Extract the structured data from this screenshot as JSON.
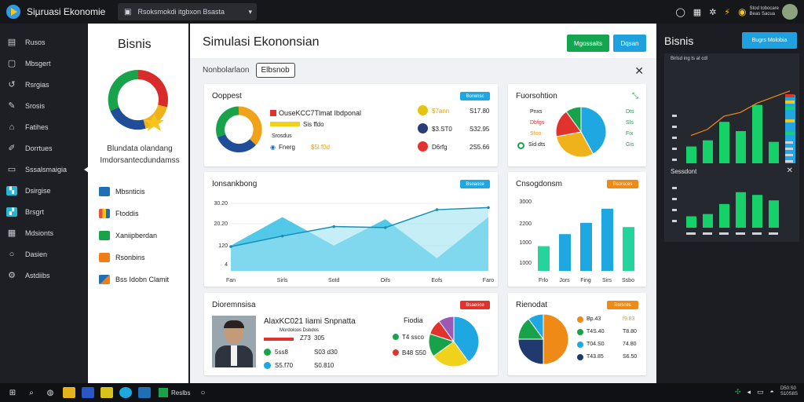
{
  "topbar": {
    "app_title": "Siµruasi Ekonomie",
    "search_text": "Rsoksmokdi itgbxon Bsasta",
    "user_line1": "Stod tobocare",
    "user_line2": "Beas Sacua"
  },
  "sidebar": {
    "items": [
      {
        "label": "Rusos",
        "icon": "grid-icon"
      },
      {
        "label": "Mbsgert",
        "icon": "window-icon"
      },
      {
        "label": "Rsrgias",
        "icon": "refresh-icon"
      },
      {
        "label": "Srosis",
        "icon": "wrench-icon"
      },
      {
        "label": "Fatihes",
        "icon": "folder-icon"
      },
      {
        "label": "Dorrtues",
        "icon": "pencil-icon"
      },
      {
        "label": "Sssalsmaigia",
        "icon": "monitor-icon"
      },
      {
        "label": "Dsirgise",
        "icon": "chart-icon"
      },
      {
        "label": "Brsgrt",
        "icon": "stats-icon"
      },
      {
        "label": "Mdsionts",
        "icon": "table-icon"
      },
      {
        "label": "Dasien",
        "icon": "circle-icon"
      },
      {
        "label": "Astdiibs",
        "icon": "gear-icon"
      }
    ]
  },
  "leftpanel": {
    "title": "Bisnis",
    "desc_line1": "Blundata olandang",
    "desc_line2": "Imdorsantecdundamss",
    "list": [
      {
        "label": "Mbsnticis",
        "color": "#1f6fb5"
      },
      {
        "label": "Ftoddis",
        "color": "#e8503a"
      },
      {
        "label": "Xaniipberdan",
        "color": "#18a34a"
      },
      {
        "label": "Rsonbins",
        "color": "#f07d18"
      },
      {
        "label": "Bss Idobn Clamit",
        "color": "#1f6fb5"
      }
    ]
  },
  "main": {
    "title": "Simulasi Ekononsian",
    "btn_green": "Mgossaits",
    "btn_blue": "Dqsan",
    "tab_label": "Nonbolarlaon",
    "tab_selected": "Elbsnob",
    "card1": {
      "title": "Ooppest",
      "badge": "Borwnsc",
      "headline": "OuseKCC7Tlmat Ibdponal",
      "r1_label": "Sis ffdo",
      "r2_label": "Srosdus",
      "r3_label": "Fnerg",
      "r3_value": "$5l.f0d",
      "right_rows": [
        {
          "label": "$7ann",
          "value": "S17.80",
          "color": "#e4c40e"
        },
        {
          "label": "$3.ST0",
          "value": "S32.95",
          "color": "#2b3d78"
        },
        {
          "label": "D6rfg",
          "value": "2S5.66",
          "color": "#e0332d"
        }
      ]
    },
    "card2": {
      "title": "Fuorsohtion",
      "legend": [
        {
          "label": "Pnxs",
          "value": "Dts",
          "color": "#1ea7e0"
        },
        {
          "label": "Dbfgs",
          "value": "Sls",
          "color": "#e0332d"
        },
        {
          "label": "Sfoo",
          "value": "Fix",
          "color": "#f0b21a"
        },
        {
          "label": "Sid dts",
          "value": "Gis",
          "color": "#18a34a"
        }
      ]
    },
    "card3": {
      "title": "Ionsankbong",
      "badge": "Bsoaoce"
    },
    "card4": {
      "title": "Cnsogdonsm",
      "badge": "Bsorsces"
    },
    "card5": {
      "title": "Dioremnsisa",
      "badge": "Bsaeoce",
      "name": "AlaxKC021 Iiami Snpnatta",
      "sub": "Mordoloos Dsbdos",
      "rows": [
        {
          "label": "Z73",
          "value": "305",
          "color": "#e0332d"
        },
        {
          "label": "5ss8",
          "value": "S03 d30",
          "color": "#18a34a"
        },
        {
          "label": "S5.f70",
          "value": "S0.810",
          "color": "#1ea7e0"
        }
      ],
      "pie_label": "Fiodia",
      "pie_rows": [
        {
          "label": "T4 ssco",
          "color": "#18a34a"
        },
        {
          "label": "B48 S50",
          "color": "#e0332d"
        }
      ]
    },
    "card6": {
      "title": "Rienodat",
      "badge": "Bsrsces",
      "legend": [
        {
          "label": "Bp.43",
          "value": "f9.83",
          "color": "#f08a16"
        },
        {
          "label": "T4S.40",
          "value": "T8.80",
          "color": "#18a34a"
        },
        {
          "label": "T04.S0",
          "value": "74.80",
          "color": "#1ea7e0"
        },
        {
          "label": "T43.85",
          "value": "S6.50",
          "color": "#1f3a6e"
        }
      ]
    }
  },
  "rightpanel": {
    "title": "Bisnis",
    "btn": "Bugrs Molobia",
    "card1_label": "Birlsd ing ts at cdl",
    "card2_title": "Sessdont"
  },
  "taskbar": {
    "app_label": "Reslbs",
    "clock1": "D50:S0",
    "clock2": "S10S8S"
  },
  "colors": {
    "accent_blue": "#1ea7e0",
    "green": "#18a34a",
    "orange": "#f08a16",
    "red": "#e0332d"
  },
  "chart_data": [
    {
      "type": "area",
      "x": [
        "Fan",
        "Sirls",
        "Sotd",
        "Oifs",
        "Eofs",
        "Faro"
      ],
      "series": [
        {
          "values": [
            120,
            255,
            120,
            245,
            60,
            255
          ]
        },
        {
          "values": [
            115,
            165,
            210,
            205,
            290,
            300
          ]
        }
      ],
      "yticks": [
        "30.20",
        "20.20",
        "120",
        "4"
      ]
    },
    {
      "type": "bar",
      "x": [
        "Frlo",
        "Jors",
        "Fing",
        "Sirs",
        "Ssbo"
      ],
      "values": [
        35,
        52,
        68,
        88,
        62
      ],
      "yticks": [
        "3000",
        "2200",
        "1000",
        "1000"
      ]
    },
    {
      "type": "pie",
      "values": [
        42,
        30,
        18,
        10
      ],
      "colors": [
        "#1ea7e0",
        "#f0b21a",
        "#e0332d",
        "#18a34a"
      ]
    },
    {
      "type": "pie",
      "values": [
        50,
        25,
        15,
        10
      ],
      "colors": [
        "#f08a16",
        "#1f3a6e",
        "#18a34a",
        "#1ea7e0"
      ]
    },
    {
      "type": "pie",
      "values": [
        40,
        25,
        15,
        10,
        10
      ],
      "colors": [
        "#1ea7e0",
        "#f0d21a",
        "#18a34a",
        "#e0332d",
        "#9b59b6"
      ]
    },
    {
      "type": "bar",
      "values": [
        28,
        36,
        60,
        48,
        82,
        34,
        95
      ],
      "line": [
        30,
        38,
        55,
        60,
        72,
        80,
        88
      ]
    },
    {
      "type": "bar",
      "values": [
        25,
        30,
        52,
        78,
        72,
        60
      ]
    }
  ]
}
